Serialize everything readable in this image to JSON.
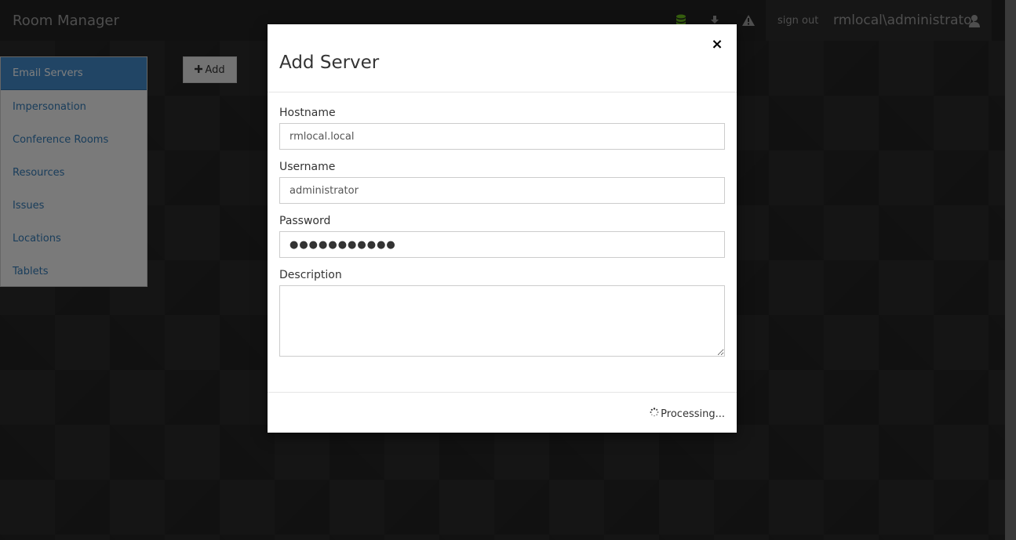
{
  "app": {
    "title": "Room Manager"
  },
  "topbar": {
    "icons": [
      "database-icon",
      "download-icon",
      "warning-icon"
    ],
    "sign_out": "sign out",
    "username": "rmlocal\\administrator",
    "colors": {
      "database": "#6cbf1f",
      "icons": "#9d9d9d"
    }
  },
  "sidebar": {
    "items": [
      {
        "label": "Email Servers",
        "active": true
      },
      {
        "label": "Impersonation"
      },
      {
        "label": "Conference Rooms"
      },
      {
        "label": "Resources"
      },
      {
        "label": "Issues"
      },
      {
        "label": "Locations"
      },
      {
        "label": "Tablets"
      }
    ]
  },
  "toolbar": {
    "add_label": "Add"
  },
  "modal": {
    "title": "Add Server",
    "close": "×",
    "fields": {
      "hostname": {
        "label": "Hostname",
        "value": "rmlocal.local"
      },
      "username": {
        "label": "Username",
        "value": "administrator"
      },
      "password": {
        "label": "Password",
        "value": "●●●●●●●●●●●"
      },
      "description": {
        "label": "Description",
        "value": ""
      }
    },
    "status": "Processing..."
  }
}
